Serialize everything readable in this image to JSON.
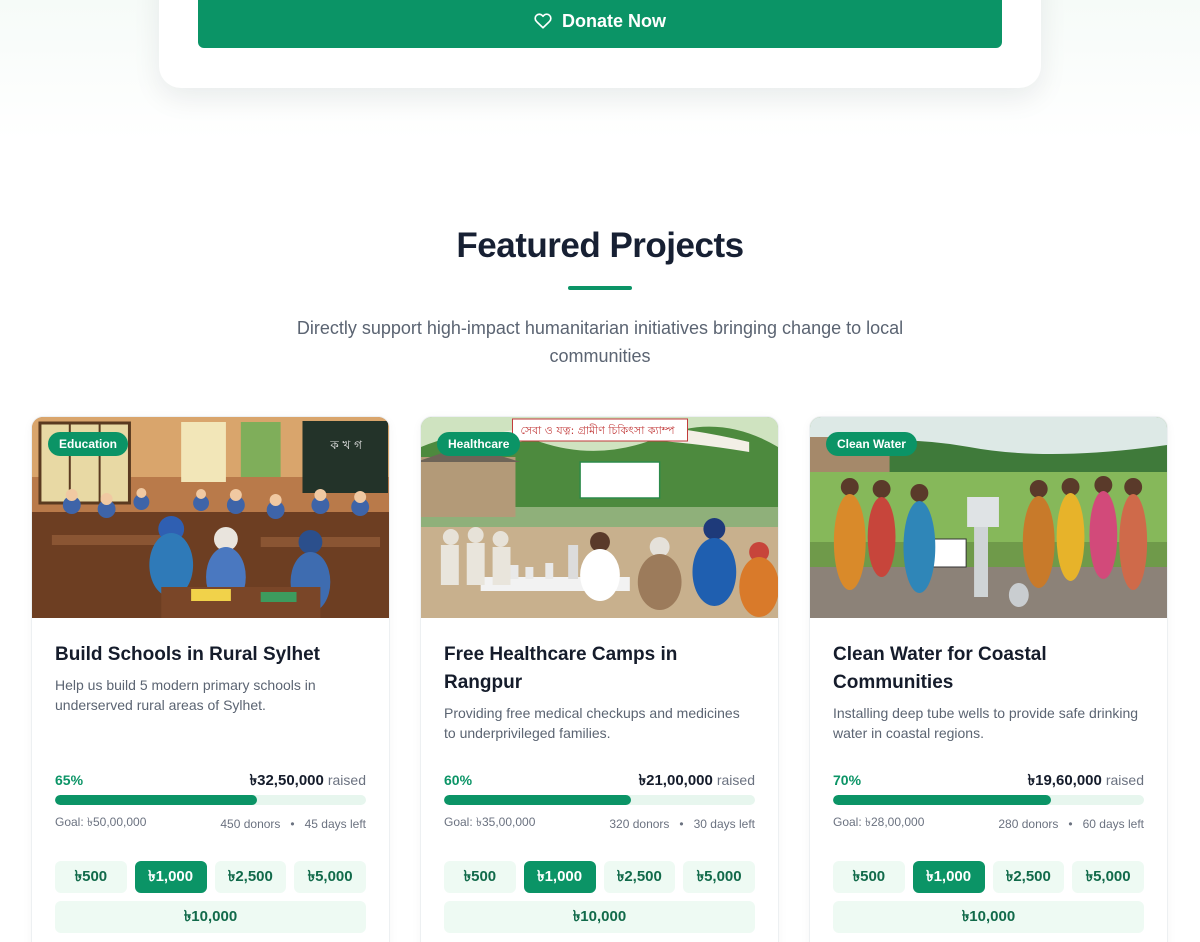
{
  "donate": {
    "label": "Donate Now"
  },
  "section": {
    "title": "Featured Projects",
    "subtitle": "Directly support high-impact humanitarian initiatives bringing change to local communities"
  },
  "colors": {
    "accent": "#0b9466",
    "accent_light": "#eefaf3",
    "text_dark": "#151c2b"
  },
  "projects": [
    {
      "category": "Education",
      "image_icon": "classroom-photo",
      "title": "Build Schools in Rural Sylhet",
      "description": "Help us build 5 modern primary schools in underserved rural areas of Sylhet.",
      "percent_label": "65%",
      "progress": 0.65,
      "raised": "৳32,50,000",
      "raised_word": "raised",
      "goal": "Goal: ৳50,00,000",
      "donors": "450 donors",
      "days_left": "45 days left",
      "amounts": [
        "৳500",
        "৳1,000",
        "৳2,500",
        "৳5,000"
      ],
      "selected_amount": "৳1,000",
      "wide_amount": "৳10,000"
    },
    {
      "category": "Healthcare",
      "image_icon": "medical-camp-photo",
      "title": "Free Healthcare Camps in Rangpur",
      "description": "Providing free medical checkups and medicines to underprivileged families.",
      "percent_label": "60%",
      "progress": 0.6,
      "raised": "৳21,00,000",
      "raised_word": "raised",
      "goal": "Goal: ৳35,00,000",
      "donors": "320 donors",
      "days_left": "30 days left",
      "amounts": [
        "৳500",
        "৳1,000",
        "৳2,500",
        "৳5,000"
      ],
      "selected_amount": "৳1,000",
      "wide_amount": "৳10,000"
    },
    {
      "category": "Clean Water",
      "image_icon": "tube-well-photo",
      "title": "Clean Water for Coastal Communities",
      "description": "Installing deep tube wells to provide safe drinking water in coastal regions.",
      "percent_label": "70%",
      "progress": 0.7,
      "raised": "৳19,60,000",
      "raised_word": "raised",
      "goal": "Goal: ৳28,00,000",
      "donors": "280 donors",
      "days_left": "60 days left",
      "amounts": [
        "৳500",
        "৳1,000",
        "৳2,500",
        "৳5,000"
      ],
      "selected_amount": "৳1,000",
      "wide_amount": "৳10,000"
    }
  ]
}
